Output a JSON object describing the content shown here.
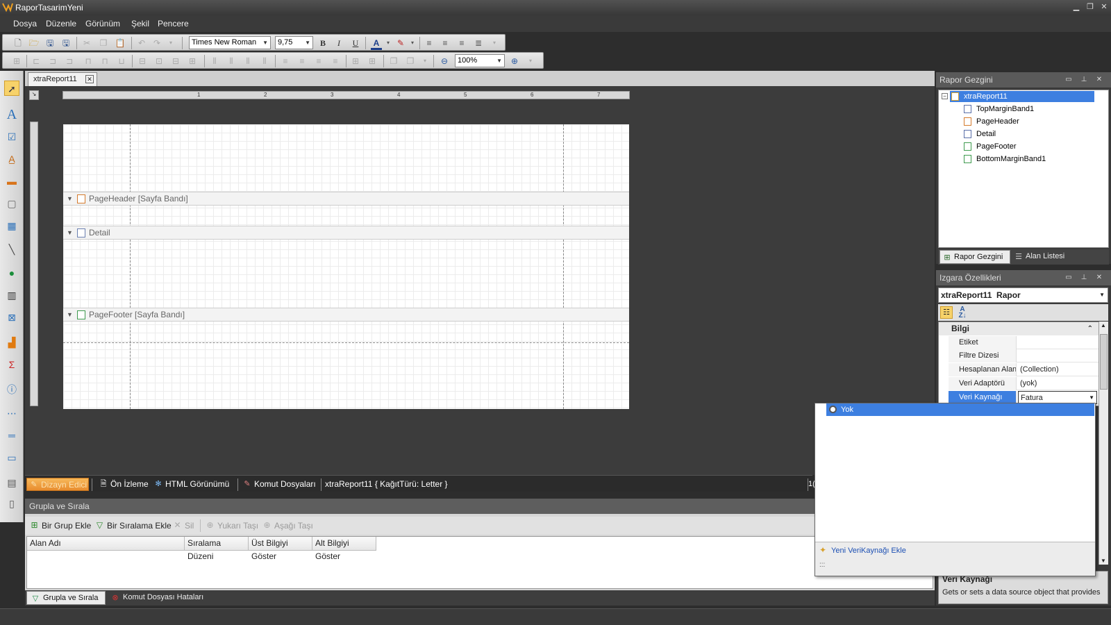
{
  "window": {
    "title": "RaporTasarimYeni",
    "min_label": "▁",
    "max_label": "❐",
    "close_label": "✕"
  },
  "menu": [
    "Dosya",
    "Düzenle",
    "Görünüm",
    "Şekil",
    "Pencere"
  ],
  "toolbar": {
    "font_name": "Times New Roman",
    "font_size": "9,75",
    "zoom": "100%",
    "bold": "B",
    "italic": "I",
    "underline": "U"
  },
  "document_tab": {
    "label": "xtraReport11",
    "close_label": "✕"
  },
  "ruler_marks": [
    "1",
    "2",
    "3",
    "4",
    "5",
    "6",
    "7"
  ],
  "bands": [
    {
      "label": "PageHeader [Sayfa Bandı]"
    },
    {
      "label": "Detail"
    },
    {
      "label": "PageFooter [Sayfa Bandı]"
    }
  ],
  "view_tabs": [
    "Dizayn Edici",
    "Ön İzleme",
    "HTML Görünümü",
    "Komut Dosyaları",
    "xtraReport11 { KağıtTürü: Letter }"
  ],
  "group_panel": {
    "title": "Grupla ve Sırala",
    "buttons": [
      "Bir Grup Ekle",
      "Bir Sıralama Ekle",
      "Sil",
      "Yukarı Taşı",
      "Aşağı Taşı"
    ],
    "columns": [
      "Alan Adı",
      "Sıralama Düzeni",
      "Üst Bilgiyi Göster",
      "Alt Bilgiyi Göster"
    ]
  },
  "bottom_tabs": [
    "Grupla ve Sırala",
    "Komut Dosyası Hataları"
  ],
  "navigator": {
    "title": "Rapor Gezgini",
    "root": "xtraReport11",
    "nodes": [
      "TopMarginBand1",
      "PageHeader",
      "Detail",
      "PageFooter",
      "BottomMarginBand1"
    ],
    "tabs": [
      "Rapor Gezgini",
      "Alan Listesi"
    ]
  },
  "properties": {
    "title": "Izgara Özellikleri",
    "object_name": "xtraReport11",
    "object_type": "Rapor",
    "category": "Bilgi",
    "rows": [
      {
        "key": "Etiket",
        "value": ""
      },
      {
        "key": "Filtre Dizesi",
        "value": ""
      },
      {
        "key": "Hesaplanan Alanl",
        "value": "(Collection)"
      },
      {
        "key": "Veri Adaptörü",
        "value": "(yok)"
      },
      {
        "key": "Veri Kaynağı",
        "value": "Fatura"
      }
    ],
    "desc_title": "Veri Kaynağı",
    "desc_text": "Gets or sets a data source object that provides"
  },
  "dropdown": {
    "option": "Yok",
    "add_label": "Yeni VeriKaynağı Ekle",
    "grip": ":::"
  },
  "status_fragment": "1("
}
